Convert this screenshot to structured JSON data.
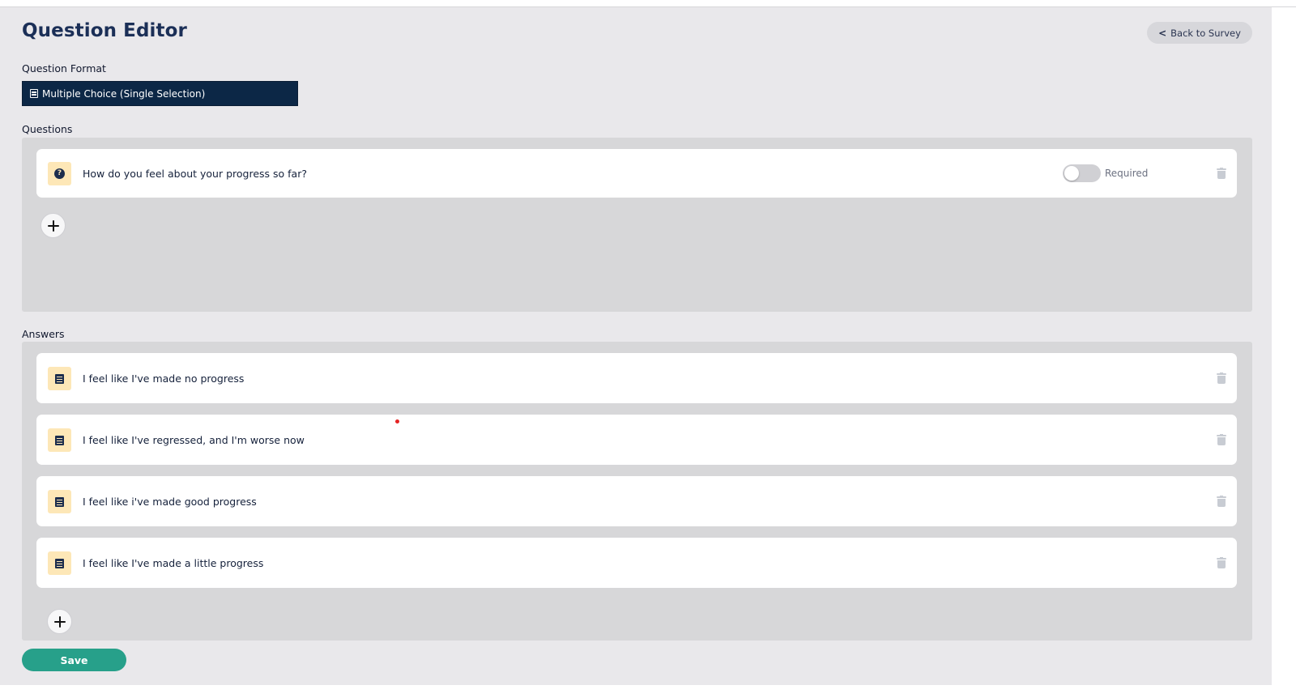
{
  "header": {
    "title": "Question Editor",
    "back_label": "< Back to Survey",
    "back_chevron": "<",
    "back_text": "Back to Survey"
  },
  "format": {
    "label": "Question Format",
    "selected_value": "Multiple Choice (Single Selection)",
    "icon": "list-icon"
  },
  "questions": {
    "label": "Questions",
    "items": [
      {
        "text": "How do you feel about your progress so far?",
        "icon": "question-circle-icon",
        "required_label": "Required",
        "required": false
      }
    ]
  },
  "answers": {
    "label": "Answers",
    "items": [
      {
        "text": "I feel like I've made no progress",
        "icon": "list-icon"
      },
      {
        "text": "I feel like I've regressed, and I'm worse now",
        "icon": "list-icon"
      },
      {
        "text": "I feel like i've made good progress",
        "icon": "list-icon"
      },
      {
        "text": "I feel like I've made a little progress",
        "icon": "list-icon"
      }
    ]
  },
  "actions": {
    "save_label": "Save"
  },
  "colors": {
    "primary_dark": "#0c2746",
    "accent_green": "#27a08a",
    "badge_bg": "#fde7b7",
    "page_bg": "#e9e8eb",
    "panel_bg": "#d7d7d9"
  }
}
